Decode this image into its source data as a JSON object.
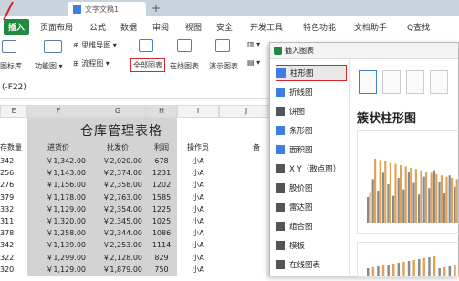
{
  "titlebar": {
    "doc_tab": "文字文稿1",
    "add_icon": "plus-icon"
  },
  "menu": [
    "插入",
    "页面布局",
    "公式",
    "数据",
    "审阅",
    "视图",
    "安全",
    "开发工具",
    "特色功能",
    "文档助手",
    "Q查找"
  ],
  "ribbon": {
    "row1": [
      "思维导图",
      "流程图"
    ],
    "items": [
      "图标库",
      "功能图",
      "全部图表",
      "在线图表",
      "演示图表"
    ]
  },
  "formula": "(-F22)",
  "sheet": {
    "title": "仓库管理表格",
    "columns": [
      "E",
      "F",
      "G",
      "H",
      "I",
      "J"
    ],
    "headers": [
      "存数量",
      "进货价",
      "批发价",
      "利润",
      "操作员",
      "备"
    ],
    "rows": [
      [
        "342",
        "￥1,342.00",
        "￥2,020.00",
        "678",
        "小A"
      ],
      [
        "256",
        "￥1,143.00",
        "￥2,374.00",
        "1231",
        "小A"
      ],
      [
        "276",
        "￥1,156.00",
        "￥2,358.00",
        "1202",
        "小A"
      ],
      [
        "379",
        "￥1,178.00",
        "￥2,763.00",
        "1585",
        "小A"
      ],
      [
        "332",
        "￥1,129.00",
        "￥2,354.00",
        "1225",
        "小A"
      ],
      [
        "311",
        "￥1,320.00",
        "￥2,345.00",
        "1025",
        "小A"
      ],
      [
        "378",
        "￥1,258.00",
        "￥2,344.00",
        "1086",
        "小A"
      ],
      [
        "342",
        "￥1,139.00",
        "￥2,253.00",
        "1114",
        "小A"
      ],
      [
        "322",
        "￥1,299.00",
        "￥2,128.00",
        "829",
        "小A"
      ],
      [
        "320",
        "￥1,129.00",
        "￥1,879.00",
        "750",
        "小A"
      ]
    ]
  },
  "dialog": {
    "title": "插入图表",
    "items": [
      {
        "label": "柱形图",
        "icon": "bar-chart-icon",
        "color": "#3d7ee0"
      },
      {
        "label": "折线图",
        "icon": "line-chart-icon",
        "color": "#3d7ee0"
      },
      {
        "label": "饼图",
        "icon": "pie-chart-icon",
        "color": "#555"
      },
      {
        "label": "条形图",
        "icon": "hbar-chart-icon",
        "color": "#3d7ee0"
      },
      {
        "label": "面积图",
        "icon": "area-chart-icon",
        "color": "#3d7ee0"
      },
      {
        "label": "X Y（散点图）",
        "icon": "scatter-icon",
        "color": "#555"
      },
      {
        "label": "股价图",
        "icon": "stock-icon",
        "color": "#555"
      },
      {
        "label": "雷达图",
        "icon": "radar-icon",
        "color": "#555"
      },
      {
        "label": "组合图",
        "icon": "combo-icon",
        "color": "#555"
      },
      {
        "label": "模板",
        "icon": "template-icon",
        "color": "#555"
      },
      {
        "label": "在线图表",
        "icon": "online-chart-icon",
        "color": "#555"
      }
    ],
    "preview_title": "簇状柱形图"
  },
  "colors": {
    "accent_red": "#d8262c",
    "brand_green": "#1e8a40",
    "bar_gray": "#8a8a8a",
    "bar_orange": "#e0a35a"
  }
}
